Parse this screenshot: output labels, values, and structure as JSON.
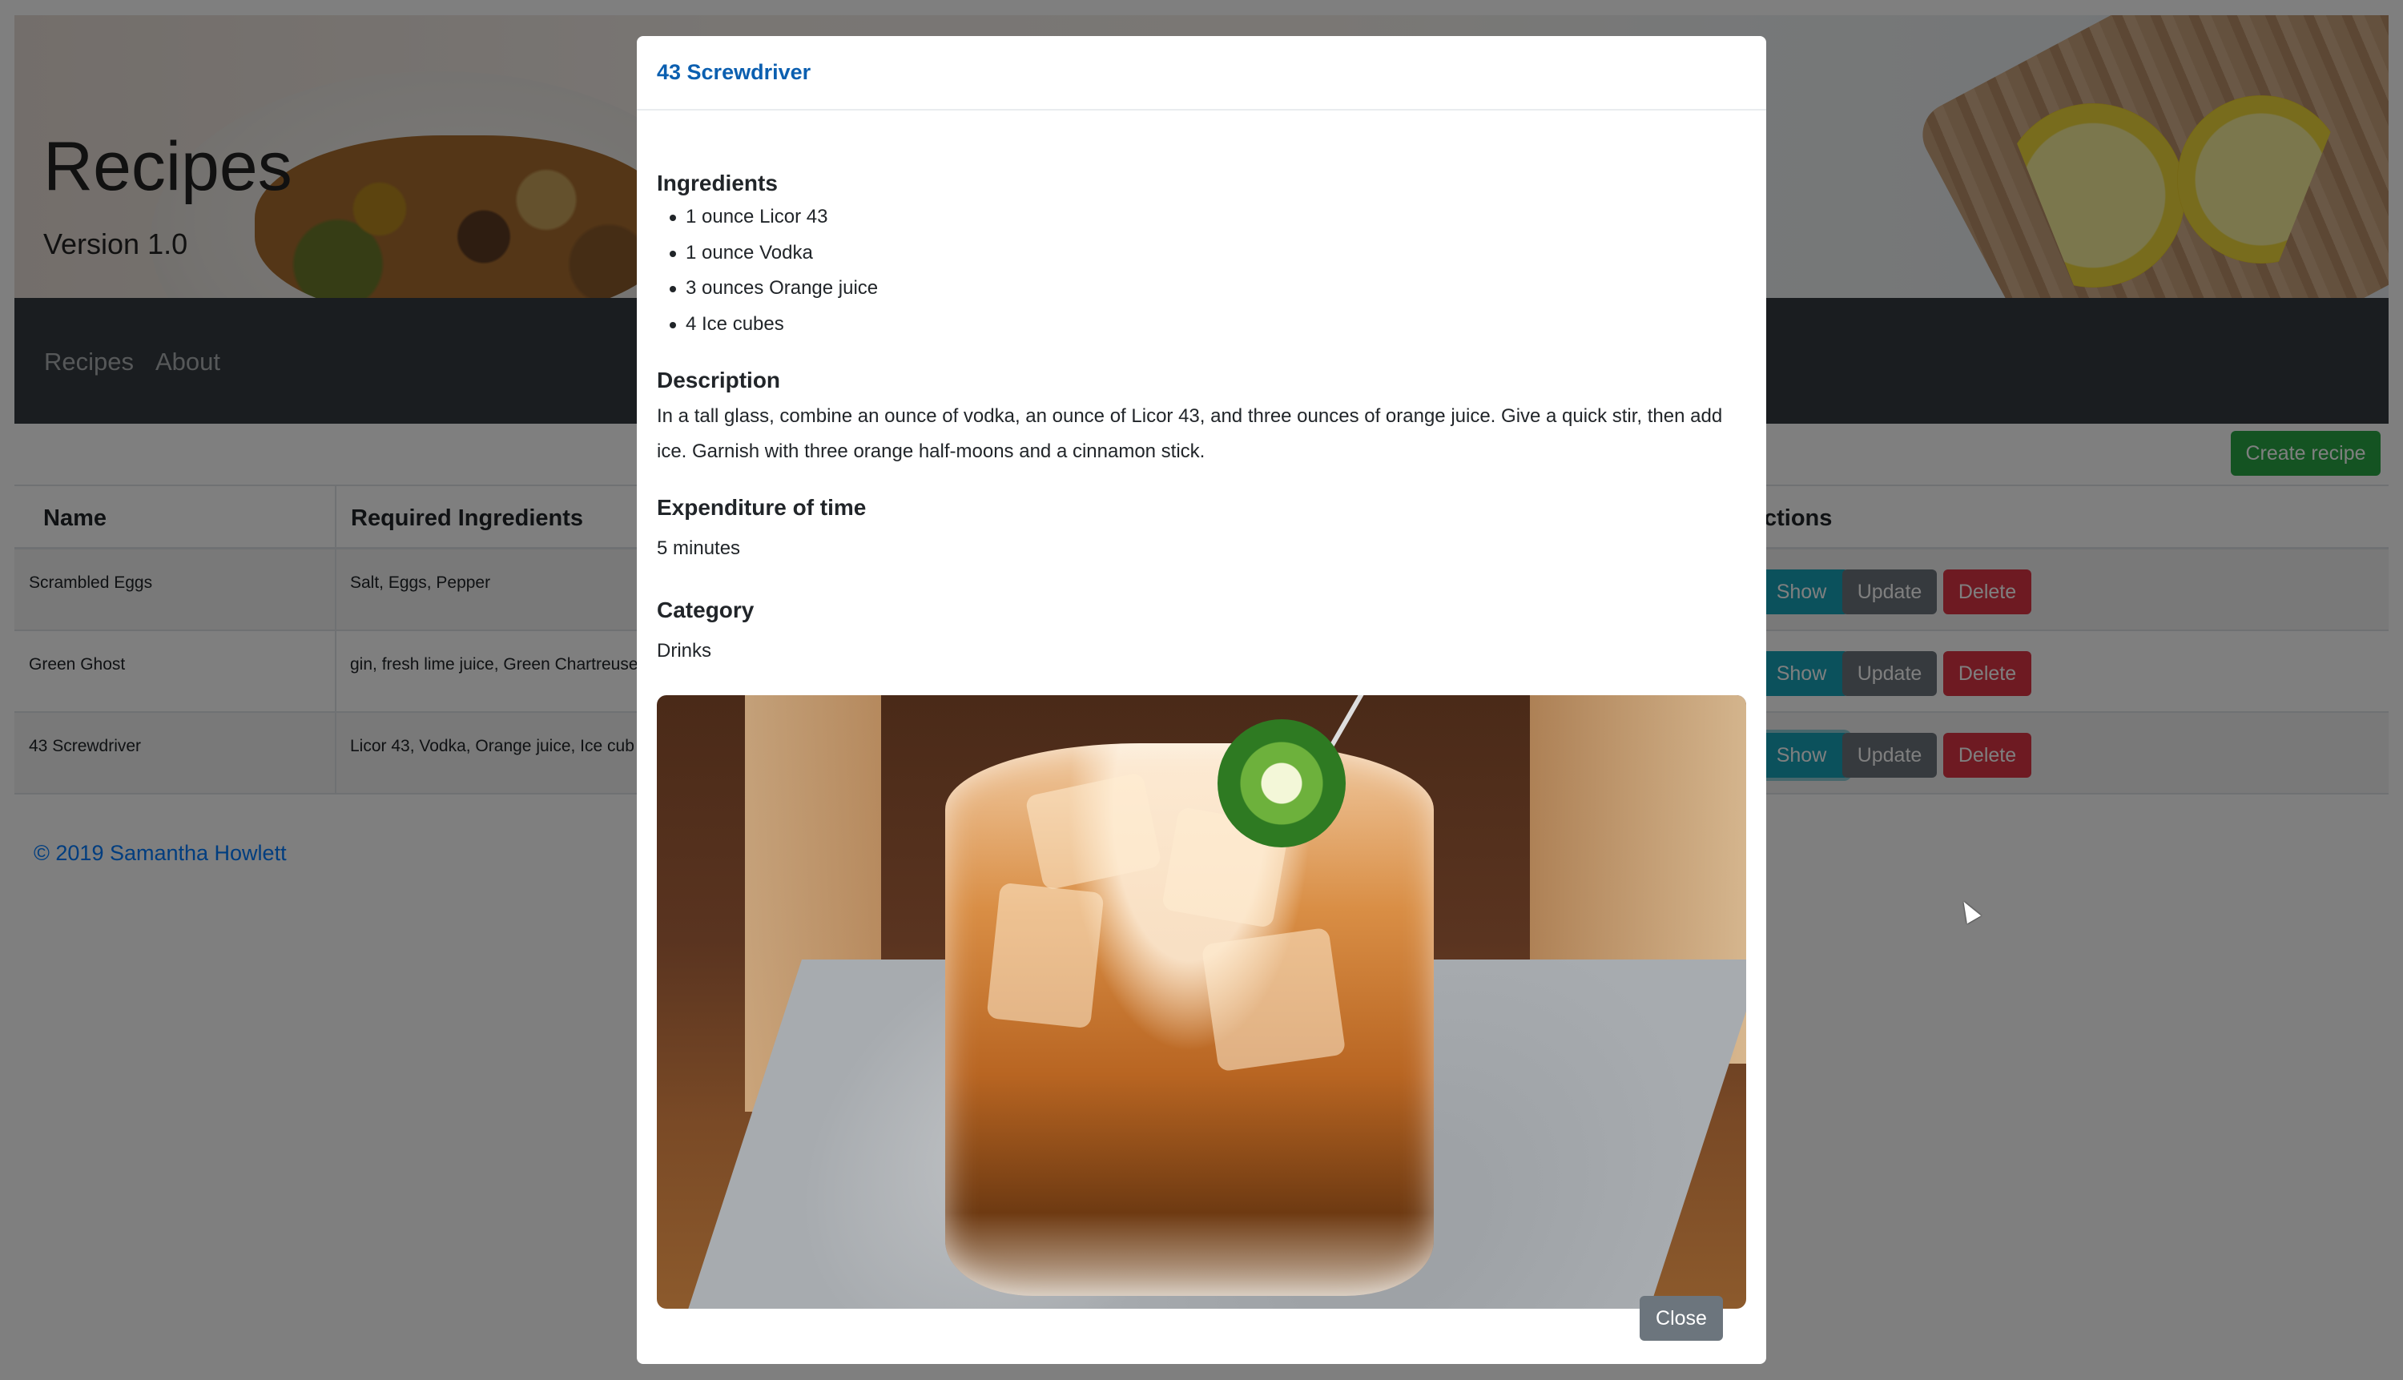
{
  "banner": {
    "title": "Recipes",
    "subtitle": "Version 1.0"
  },
  "nav": {
    "items": [
      "Recipes",
      "About"
    ]
  },
  "toolbar": {
    "create_label": "Create recipe"
  },
  "table": {
    "headers": [
      "Name",
      "Required Ingredients",
      "Actions"
    ],
    "header_actions_visible": "ctions",
    "rows": [
      {
        "name": "Scrambled Eggs",
        "ingredients": "Salt, Eggs, Pepper"
      },
      {
        "name": "Green Ghost",
        "ingredients": "gin, fresh lime juice, Green Chartreuse"
      },
      {
        "name": "43 Screwdriver",
        "ingredients": "Licor 43, Vodka, Orange juice, Ice cub"
      }
    ],
    "actions": {
      "show": "Show",
      "update": "Update",
      "delete": "Delete"
    }
  },
  "footer": {
    "text": "© 2019 Samantha Howlett"
  },
  "modal": {
    "title": "43 Screwdriver",
    "ingredients_heading": "Ingredients",
    "ingredients": [
      "1 ounce Licor 43",
      "1 ounce Vodka",
      "3 ounces Orange juice",
      "4 Ice cubes"
    ],
    "description_heading": "Description",
    "description": "In a tall glass, combine an ounce of vodka, an ounce of Licor 43, and three ounces of orange juice. Give a quick stir, then add ice. Garnish with three orange half-moons and a cinnamon stick.",
    "time_heading": "Expenditure of time",
    "time": "5 minutes",
    "category_heading": "Category",
    "category": "Drinks",
    "close_label": "Close"
  },
  "colors": {
    "navbar": "#343a40",
    "success": "#28a745",
    "info": "#17a2b8",
    "secondary": "#6c757d",
    "danger": "#dc3545",
    "link": "#007bff",
    "modal_title": "#0b5fb0"
  }
}
